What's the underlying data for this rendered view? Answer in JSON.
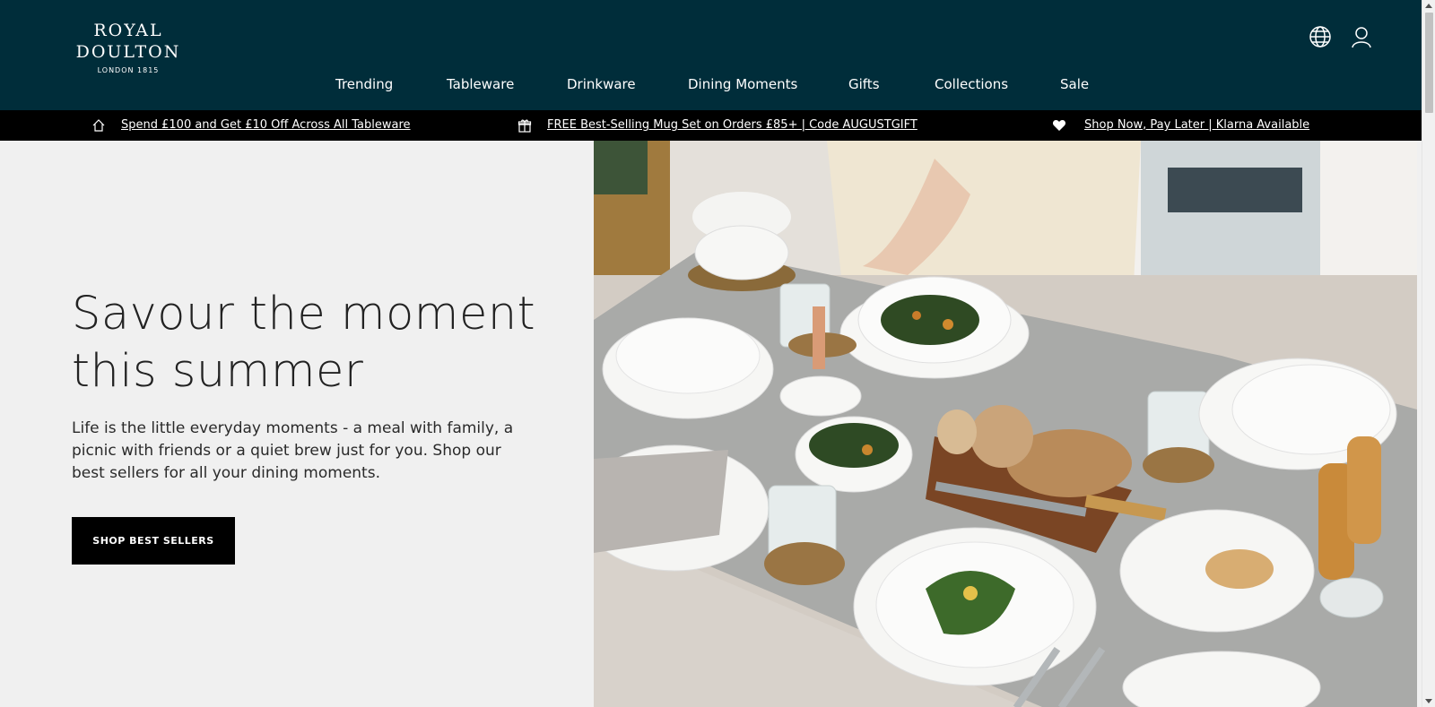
{
  "brand": {
    "name": "ROYAL DOULTON",
    "tagline": "LONDON 1815"
  },
  "header": {
    "icons": [
      "globe-icon",
      "user-icon"
    ],
    "nav": [
      "Trending",
      "Tableware",
      "Drinkware",
      "Dining Moments",
      "Gifts",
      "Collections",
      "Sale"
    ]
  },
  "promo_bar": {
    "items": [
      {
        "icon": "home-icon",
        "text": "Spend £100 and Get £10 Off Across All Tableware"
      },
      {
        "icon": "gift-icon",
        "text": "FREE Best-Selling Mug Set on Orders £85+ | Code AUGUSTGIFT"
      },
      {
        "icon": "heart-icon",
        "text": "Shop Now, Pay Later | Klarna Available"
      }
    ]
  },
  "hero": {
    "title_line1": "Savour the moment",
    "title_line2": "this summer",
    "description": "Life is the little everyday moments - a meal with family, a picnic with friends or a quiet brew just for you. Shop our best sellers for all your dining moments.",
    "cta": "SHOP BEST SELLERS"
  },
  "colors": {
    "header_bg": "#002d3a",
    "promo_bg": "#000000",
    "hero_bg": "#f0f0f0",
    "button_bg": "#000000"
  }
}
